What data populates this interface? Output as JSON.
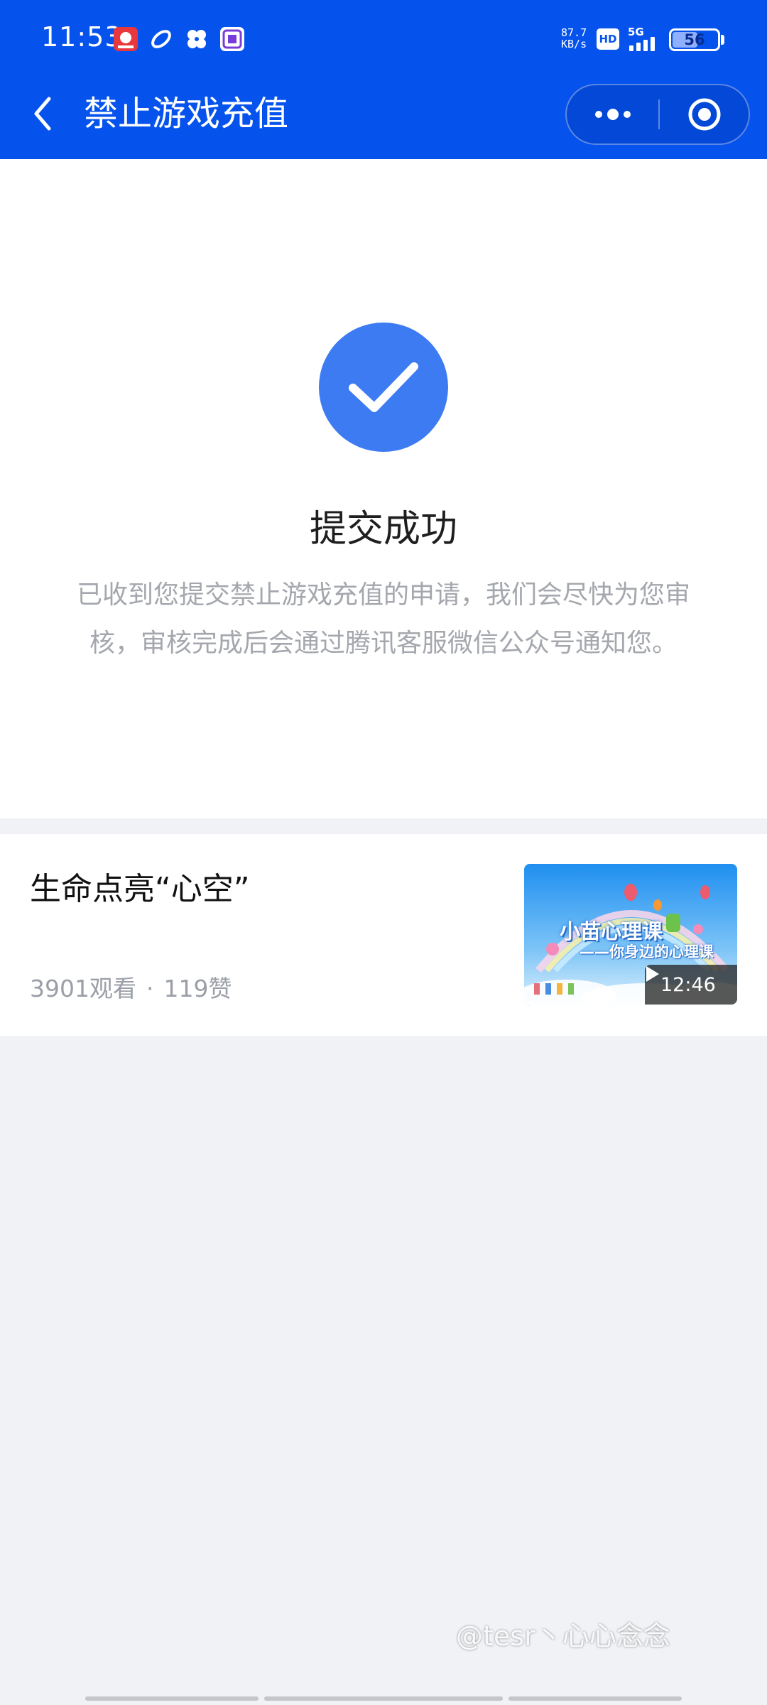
{
  "status_bar": {
    "time": "11:53",
    "net_speed_value": "87.7",
    "net_speed_unit": "KB/s",
    "hd_label": "HD",
    "network_type": "5G",
    "battery_level": "56",
    "notification_icons": [
      "app-notification-icon",
      "swirl-icon",
      "fan-icon",
      "sticker-icon"
    ]
  },
  "nav": {
    "title": "禁止游戏充值"
  },
  "success": {
    "title": "提交成功",
    "description": "已收到您提交禁止游戏充值的申请，我们会尽快为您审核，审核完成后会通过腾讯客服微信公众号通知您。"
  },
  "video": {
    "title": "生命点亮“心空”",
    "views": "3901观看",
    "separator": "·",
    "likes": "119赞",
    "thumbnail_line1": "小苗心理课",
    "thumbnail_line2": "——你身边的心理课",
    "duration": "12:46"
  },
  "watermark": "@tesr丶心心念念",
  "colors": {
    "header_blue": "#0553ec",
    "success_blue": "#3d7bf2",
    "background_gray": "#f0f2f6"
  }
}
